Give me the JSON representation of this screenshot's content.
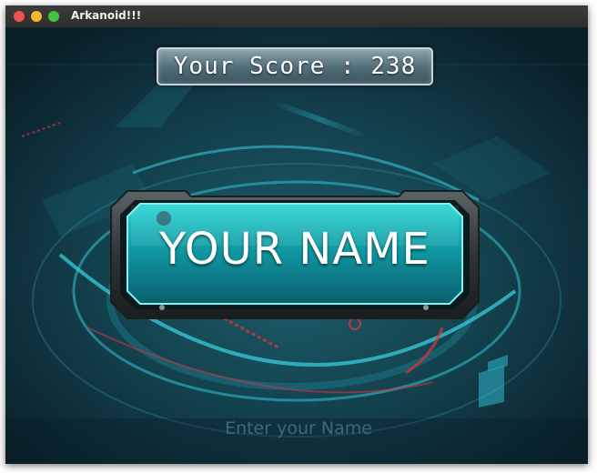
{
  "window": {
    "title": "Arkanoid!!!"
  },
  "score": {
    "text": "Your Score : 238"
  },
  "name_panel": {
    "text": "YOUR NAME"
  },
  "name_input": {
    "placeholder": "Enter your Name",
    "value": ""
  },
  "colors": {
    "accent": "#1fb8c9",
    "background": "#0c2630",
    "alert_red": "#d9333a"
  }
}
